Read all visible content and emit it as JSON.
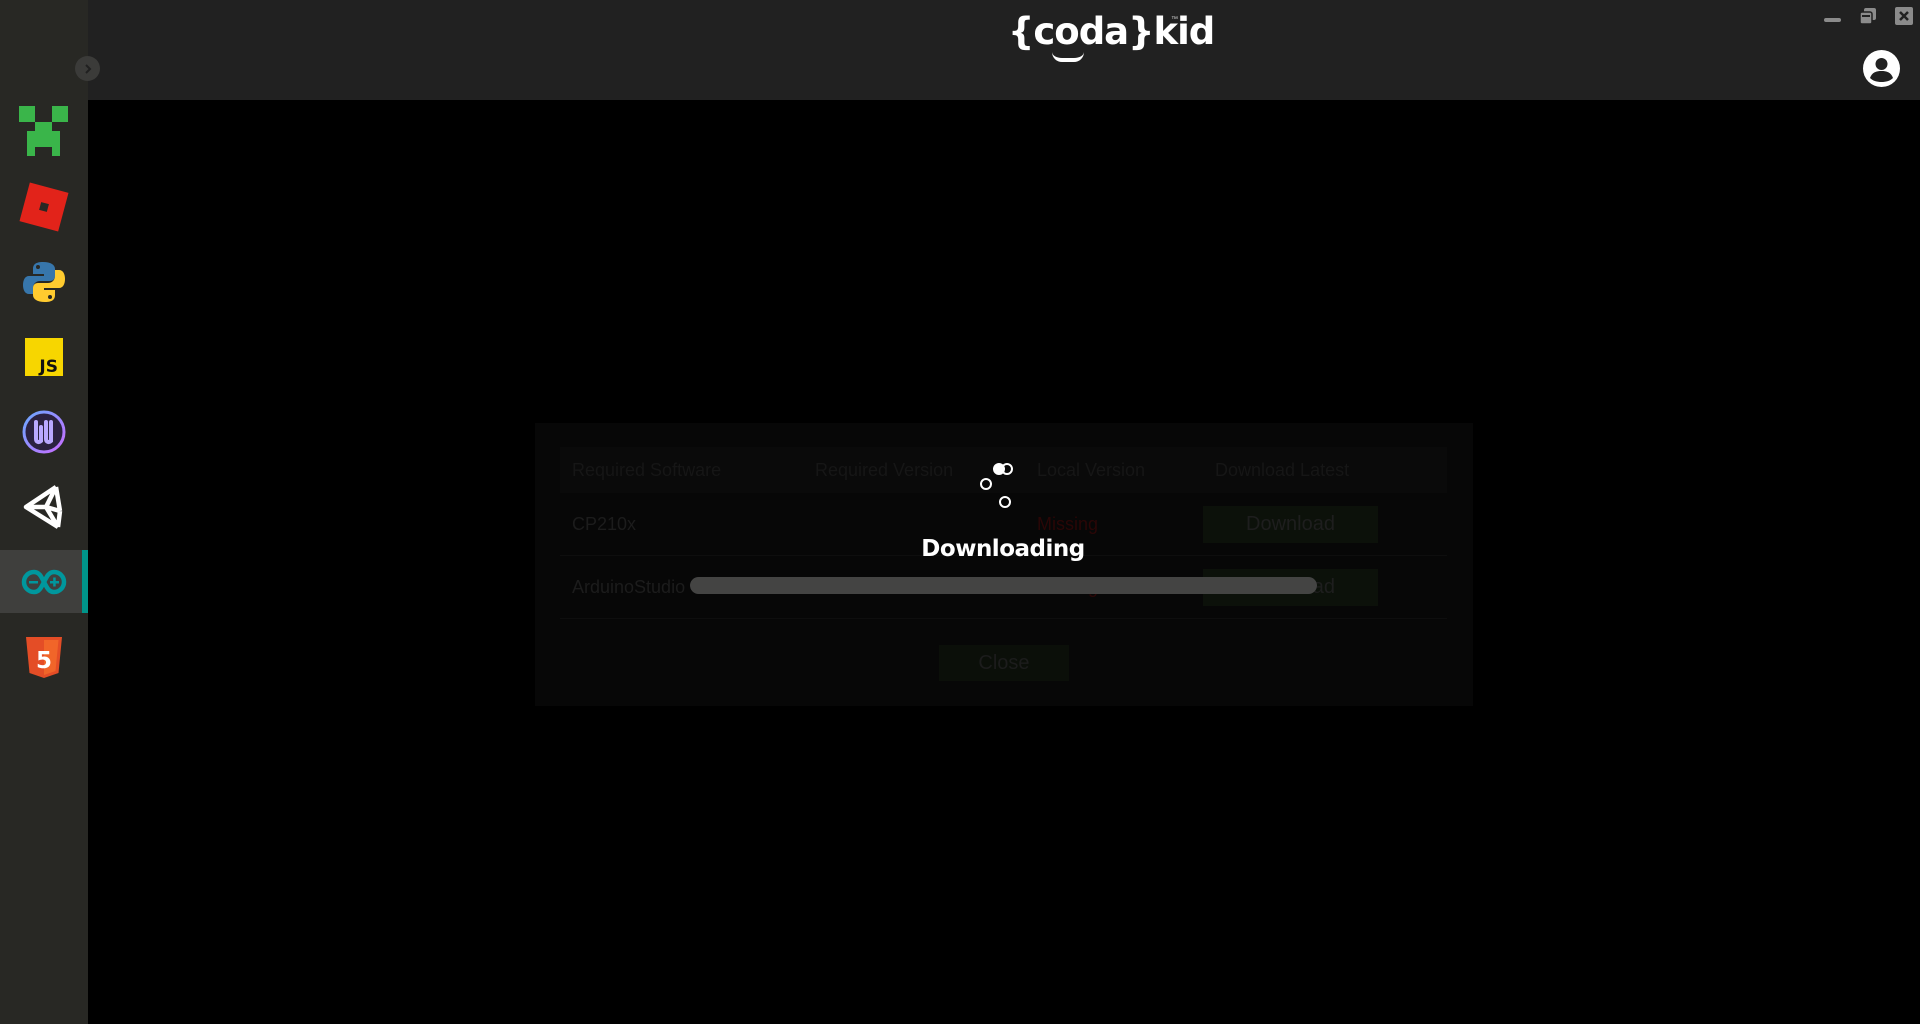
{
  "app": {
    "logo_text": "{coda}kid",
    "logo_tm": "™"
  },
  "window_controls": {
    "minimize": "minimize-icon",
    "restore": "restore-icon",
    "close": "close-icon"
  },
  "sidebar": {
    "toggle_icon": "chevron-right-icon",
    "active_index": 6,
    "accent_color": "#00958a",
    "items": [
      {
        "id": "minecraft",
        "icon": "minecraft-creeper-icon"
      },
      {
        "id": "roblox",
        "icon": "roblox-icon"
      },
      {
        "id": "python",
        "icon": "python-icon"
      },
      {
        "id": "javascript",
        "icon": "javascript-icon",
        "label": "JS"
      },
      {
        "id": "unreal",
        "icon": "unreal-engine-icon"
      },
      {
        "id": "unity",
        "icon": "unity-icon"
      },
      {
        "id": "arduino",
        "icon": "arduino-icon"
      },
      {
        "id": "html5",
        "icon": "html5-icon",
        "label": "5"
      }
    ]
  },
  "dialog": {
    "headers": [
      "Required Software",
      "Required Version",
      "Local Version",
      "Download Latest"
    ],
    "rows": [
      {
        "software": "CP210x",
        "required_version": "",
        "local_version": "Missing",
        "action": "Download"
      },
      {
        "software": "ArduinoStudio",
        "required_version": "",
        "local_version": "Missing",
        "action": "Download"
      }
    ],
    "close_label": "Close"
  },
  "download_overlay": {
    "status_text": "Downloading",
    "progress_percent": 100
  },
  "colors": {
    "sidebar_bg": "#282824",
    "topbar_bg": "#212121",
    "missing_text": "#ff1a1a",
    "download_button": "#3a5a1f"
  }
}
